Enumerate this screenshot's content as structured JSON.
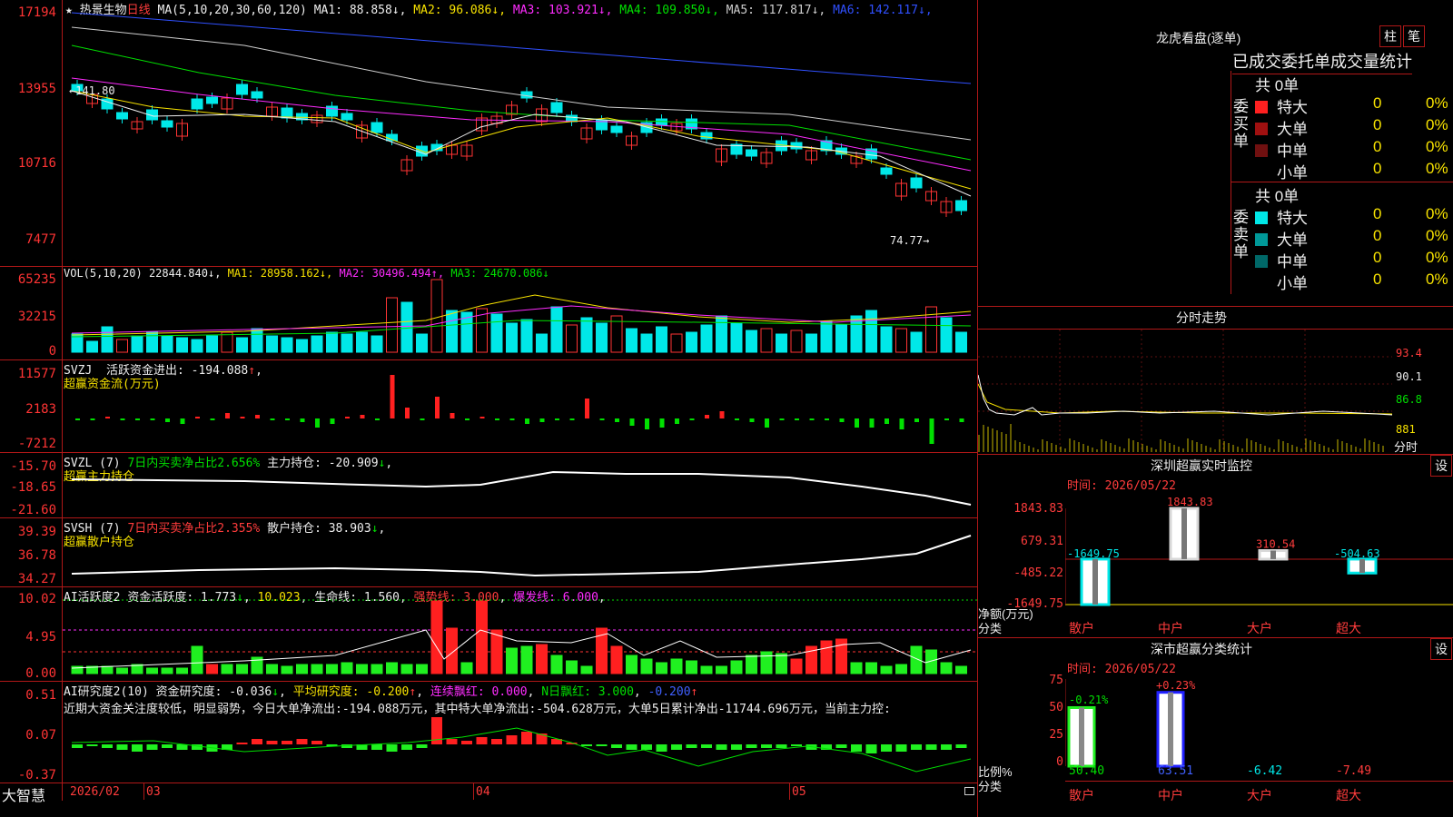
{
  "price": {
    "title": "热景生物",
    "period": "日线",
    "ma_header": "MA(5,10,20,30,60,120)",
    "ma": [
      {
        "label": "MA1: 88.858",
        "arrow": "↓",
        "color": "#eeeeee"
      },
      {
        "label": "MA2: 96.086",
        "arrow": "↓",
        "color": "#f7e200"
      },
      {
        "label": "MA3: 103.921",
        "arrow": "↓",
        "color": "#ff2cff"
      },
      {
        "label": "MA4: 109.850",
        "arrow": "↓",
        "color": "#00e000"
      },
      {
        "label": "MA5: 117.817",
        "arrow": "↓",
        "color": "#cfcfcf"
      },
      {
        "label": "MA6: 142.117",
        "arrow": "↓",
        "color": "#3050ff"
      }
    ],
    "yticks": [
      "17194",
      "13955",
      "10716",
      "7477"
    ],
    "hi_label": "←141.80",
    "lo_label": "74.77→"
  },
  "vol": {
    "header": "VOL(5,10,20)",
    "value": "22844.840",
    "ma1": "MA1: 28958.162",
    "ma2": "MA2: 30496.494",
    "ma3": "MA3: 24670.086",
    "yticks": [
      "65235",
      "32215",
      "0"
    ]
  },
  "svzj": {
    "header": "SVZJ",
    "label": "活跃资金进出: -194.088",
    "sub": "超赢资金流(万元)",
    "yticks": [
      "11577",
      "2183",
      "-7212"
    ]
  },
  "svzl": {
    "header": "SVZL (7)",
    "ratio": "7日内买卖净占比2.656%",
    "hold": "主力持仓: -20.909",
    "sub": "超赢主力持仓",
    "yticks": [
      "-15.70",
      "-18.65",
      "-21.60"
    ]
  },
  "svsh": {
    "header": "SVSH (7)",
    "ratio": "7日内买卖净占比2.355%",
    "hold": "散户持仓: 38.903",
    "sub": "超赢散户持仓",
    "yticks": [
      "39.39",
      "36.78",
      "34.27"
    ]
  },
  "ai_active": {
    "header": "AI活跃度2",
    "v1": "资金活跃度: 1.773",
    "v2": "10.023",
    "v3": "生命线: 1.560",
    "v4": "强势线: 3.000",
    "v5": "爆发线: 6.000",
    "yticks": [
      "10.02",
      "4.95",
      "0.00"
    ]
  },
  "ai_research": {
    "header": "AI研究度2(10)",
    "v1": "资金研究度: -0.036",
    "v2": "平均研究度: -0.200",
    "v3": "连续飘红: 0.000",
    "v4": "N日飘红: 3.000",
    "v5": "-0.200",
    "text": "近期大资金关注度较低，明显弱势，今日大单净流出:-194.088万元，其中特大单净流出:-504.628万元，大单5日累计净出-11744.696万元，当前主力控:",
    "yticks": [
      "0.51",
      "0.07",
      "-0.37"
    ]
  },
  "xaxis": {
    "brand": "大智慧",
    "labels": [
      "2026/02",
      "03",
      "04",
      "05"
    ]
  },
  "dragon": {
    "title": "龙虎看盘(逐单)",
    "btn1": "柱",
    "btn2": "笔",
    "subtitle": "已成交委托单成交量统计",
    "buy_label": "委买单",
    "sell_label": "委卖单",
    "buy_total": "共 0单",
    "sell_total": "共 0单",
    "buy_rows": [
      {
        "name": "特大",
        "n": "0",
        "p": "0%",
        "color": "#ff2020"
      },
      {
        "name": "大单",
        "n": "0",
        "p": "0%",
        "color": "#a01010"
      },
      {
        "name": "中单",
        "n": "0",
        "p": "0%",
        "color": "#701010"
      },
      {
        "name": "小单",
        "n": "0",
        "p": "0%",
        "color": ""
      }
    ],
    "sell_rows": [
      {
        "name": "特大",
        "n": "0",
        "p": "0%",
        "color": "#00e8e8"
      },
      {
        "name": "大单",
        "n": "0",
        "p": "0%",
        "color": "#009898"
      },
      {
        "name": "中单",
        "n": "0",
        "p": "0%",
        "color": "#006868"
      },
      {
        "name": "小单",
        "n": "0",
        "p": "0%",
        "color": ""
      }
    ]
  },
  "intraday": {
    "title": "分时走势",
    "yticks": [
      "93.4",
      "90.1",
      "86.8",
      "881"
    ],
    "unit": "分时"
  },
  "monitor": {
    "title": "深圳超赢实时监控",
    "btn": "设",
    "time": "时间: 2026/05/22",
    "yticks": [
      "1843.83",
      "679.31",
      "-485.22",
      "-1649.75"
    ],
    "ylabel": "净额(万元)",
    "xlabel": "分类",
    "cats": [
      "散户",
      "中户",
      "大户",
      "超大"
    ],
    "values": [
      "-1649.75",
      "1843.83",
      "310.54",
      "-504.63"
    ]
  },
  "classify": {
    "title": "深市超赢分类统计",
    "btn": "设",
    "time": "时间: 2026/05/22",
    "yticks": [
      "75",
      "50",
      "25",
      "0"
    ],
    "ylabel": "比例%",
    "xlabel": "分类",
    "cats": [
      "散户",
      "中户",
      "大户",
      "超大"
    ],
    "top_values": [
      "-0.21%",
      "+0.23%"
    ],
    "bottom_values": [
      "50.40",
      "63.51",
      "-6.42",
      "-7.49"
    ]
  },
  "chart_data": {
    "type": "bar",
    "categories": [
      "散户",
      "中户",
      "大户",
      "超大"
    ],
    "values": [
      -1649.75,
      1843.83,
      310.54,
      -504.63
    ],
    "title": "深圳超赢实时监控",
    "xlabel": "分类",
    "ylabel": "净额(万元)",
    "ylim": [
      -1649.75,
      1843.83
    ]
  }
}
